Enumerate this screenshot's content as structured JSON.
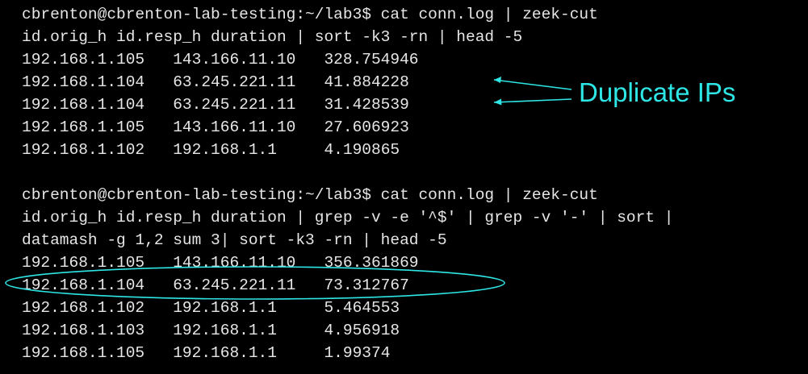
{
  "terminal": {
    "block1": {
      "prompt": "cbrenton@cbrenton-lab-testing:~/lab3$ cat conn.log | zeek-cut",
      "command_cont": "id.orig_h id.resp_h duration | sort -k3 -rn | head -5",
      "rows": [
        {
          "orig": "192.168.1.105",
          "resp": "143.166.11.10",
          "value": "328.754946"
        },
        {
          "orig": "192.168.1.104",
          "resp": "63.245.221.11",
          "value": "41.884228"
        },
        {
          "orig": "192.168.1.104",
          "resp": "63.245.221.11",
          "value": "31.428539"
        },
        {
          "orig": "192.168.1.105",
          "resp": "143.166.11.10",
          "value": "27.606923"
        },
        {
          "orig": "192.168.1.102",
          "resp": "192.168.1.1",
          "value": "4.190865"
        }
      ]
    },
    "block2": {
      "prompt": "cbrenton@cbrenton-lab-testing:~/lab3$ cat conn.log | zeek-cut",
      "command_cont1": "id.orig_h id.resp_h duration | grep -v -e '^$' | grep -v '-' | sort |",
      "command_cont2": "datamash -g 1,2 sum 3| sort -k3 -rn | head -5",
      "rows": [
        {
          "orig": "192.168.1.105",
          "resp": "143.166.11.10",
          "value": "356.361869"
        },
        {
          "orig": "192.168.1.104",
          "resp": "63.245.221.11",
          "value": "73.312767"
        },
        {
          "orig": "192.168.1.102",
          "resp": "192.168.1.1",
          "value": "5.464553"
        },
        {
          "orig": "192.168.1.103",
          "resp": "192.168.1.1",
          "value": "4.956918"
        },
        {
          "orig": "192.168.1.105",
          "resp": "192.168.1.1",
          "value": "1.99374"
        }
      ]
    }
  },
  "annotation": {
    "label": "Duplicate IPs",
    "color": "#2ee6e6",
    "arrow_icon": "arrow-left-icon",
    "highlight_shape": "ellipse"
  },
  "colors": {
    "background": "#000000",
    "text": "#e6e6e6",
    "accent": "#2ee6e6"
  }
}
